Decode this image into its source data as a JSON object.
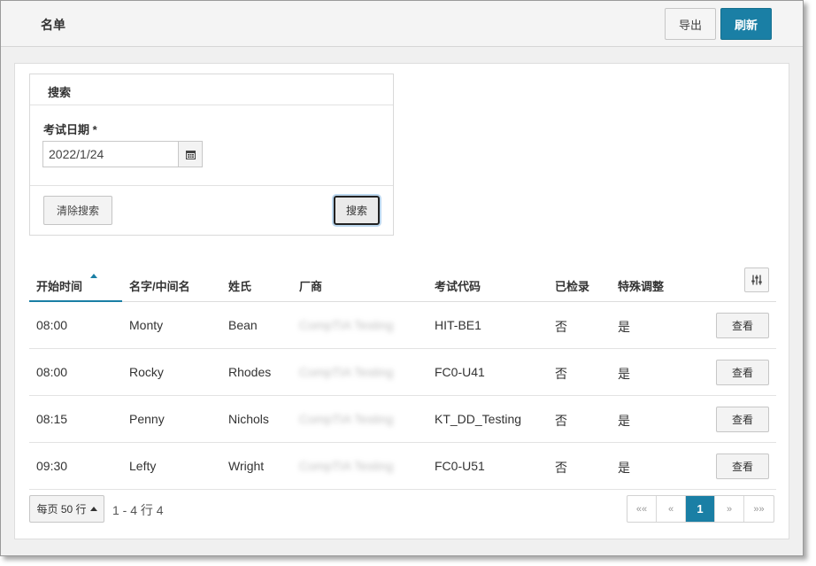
{
  "header": {
    "title": "名单",
    "export_label": "导出",
    "refresh_label": "刷新"
  },
  "search": {
    "panel_title": "搜索",
    "date_label": "考试日期 *",
    "date_value": "2022/1/24",
    "clear_label": "清除搜索",
    "search_label": "搜索"
  },
  "table": {
    "columns": [
      "开始时间",
      "名字/中间名",
      "姓氏",
      "厂商",
      "考试代码",
      "已检录",
      "特殊调整"
    ],
    "view_label": "查看",
    "rows": [
      {
        "start": "08:00",
        "first": "Monty",
        "last": "Bean",
        "vendor": "CompTIA Testing",
        "code": "HIT-BE1",
        "checked_in": "否",
        "accommodation": "是"
      },
      {
        "start": "08:00",
        "first": "Rocky",
        "last": "Rhodes",
        "vendor": "CompTIA Testing",
        "code": "FC0-U41",
        "checked_in": "否",
        "accommodation": "是"
      },
      {
        "start": "08:15",
        "first": "Penny",
        "last": "Nichols",
        "vendor": "CompTIA Testing",
        "code": "KT_DD_Testing",
        "checked_in": "否",
        "accommodation": "是"
      },
      {
        "start": "09:30",
        "first": "Lefty",
        "last": "Wright",
        "vendor": "CompTIA Testing",
        "code": "FC0-U51",
        "checked_in": "否",
        "accommodation": "是"
      }
    ]
  },
  "footer": {
    "page_size_label": "每页 50 行",
    "row_count": "1 - 4 行 4",
    "pager": {
      "first": "««",
      "prev": "«",
      "current": "1",
      "next": "»",
      "last": "»»"
    }
  },
  "colors": {
    "accent": "#1a7fa5"
  }
}
